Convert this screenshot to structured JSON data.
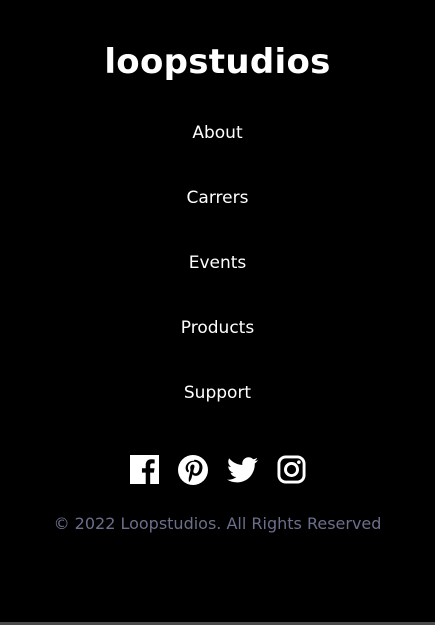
{
  "footer": {
    "logo": "loopstudios",
    "nav": [
      {
        "label": "About"
      },
      {
        "label": "Carrers"
      },
      {
        "label": "Events"
      },
      {
        "label": "Products"
      },
      {
        "label": "Support"
      }
    ],
    "social": [
      {
        "icon": "facebook-icon"
      },
      {
        "icon": "pinterest-icon"
      },
      {
        "icon": "twitter-icon"
      },
      {
        "icon": "instagram-icon"
      }
    ],
    "copyright": "© 2022 Loopstudios. All Rights Reserved"
  },
  "colors": {
    "background": "#000000",
    "text": "#ffffff",
    "copyright_text": "#6b6f8a"
  }
}
